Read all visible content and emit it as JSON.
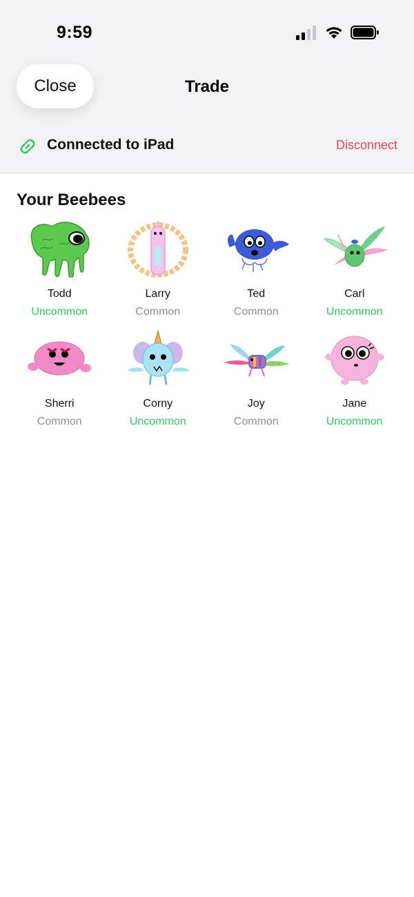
{
  "status_bar": {
    "time": "9:59",
    "signal_icon": "cellular-signal-icon",
    "wifi_icon": "wifi-icon",
    "battery_icon": "battery-icon"
  },
  "nav": {
    "close_label": "Close",
    "title": "Trade"
  },
  "connection": {
    "icon": "link-icon",
    "label": "Connected to iPad",
    "disconnect_label": "Disconnect"
  },
  "section": {
    "title": "Your Beebees"
  },
  "colors": {
    "uncommon": "#34c759",
    "common": "#8e8e93",
    "disconnect": "#ee4457",
    "link": "#34c759"
  },
  "beebees": [
    {
      "name": "Todd",
      "rarity": "Uncommon",
      "art": "green-slime-creature"
    },
    {
      "name": "Larry",
      "rarity": "Common",
      "art": "pink-fuzzy-creature-with-orange-halo"
    },
    {
      "name": "Ted",
      "rarity": "Common",
      "art": "blue-bug-eyed-creature"
    },
    {
      "name": "Carl",
      "rarity": "Uncommon",
      "art": "green-winged-bug"
    },
    {
      "name": "Sherri",
      "rarity": "Common",
      "art": "pink-blob-creature"
    },
    {
      "name": "Corny",
      "rarity": "Uncommon",
      "art": "light-blue-unicorn-creature"
    },
    {
      "name": "Joy",
      "rarity": "Common",
      "art": "rainbow-winged-creature"
    },
    {
      "name": "Jane",
      "rarity": "Uncommon",
      "art": "pink-round-creature"
    }
  ]
}
